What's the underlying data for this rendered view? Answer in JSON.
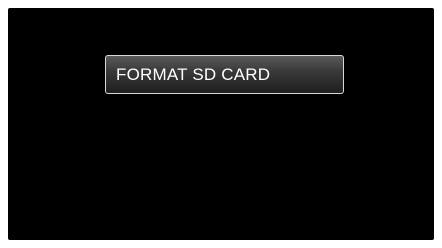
{
  "menu": {
    "items": [
      {
        "label": "FORMAT SD CARD"
      }
    ]
  }
}
